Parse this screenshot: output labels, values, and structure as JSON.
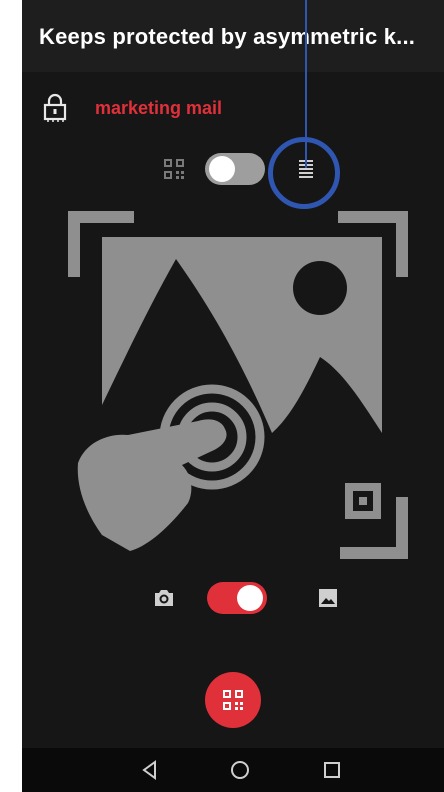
{
  "appbar": {
    "title": "Keeps protected by asymmetric k..."
  },
  "account": {
    "name": "marketing mail",
    "icon": "lock-icon"
  },
  "mode_toggle": {
    "left_icon": "qr-code-icon",
    "right_icon": "list-icon",
    "state": "off"
  },
  "source_toggle": {
    "left_icon": "camera-icon",
    "right_icon": "gallery-icon",
    "state": "on"
  },
  "fab": {
    "icon": "qr-code-icon"
  },
  "navbar": {
    "buttons": [
      "back-icon",
      "home-icon",
      "recents-icon"
    ]
  },
  "colors": {
    "accent": "#e0303a",
    "background": "#161616",
    "annotation": "#2f56b0",
    "illustration": "#8f8f8f"
  }
}
